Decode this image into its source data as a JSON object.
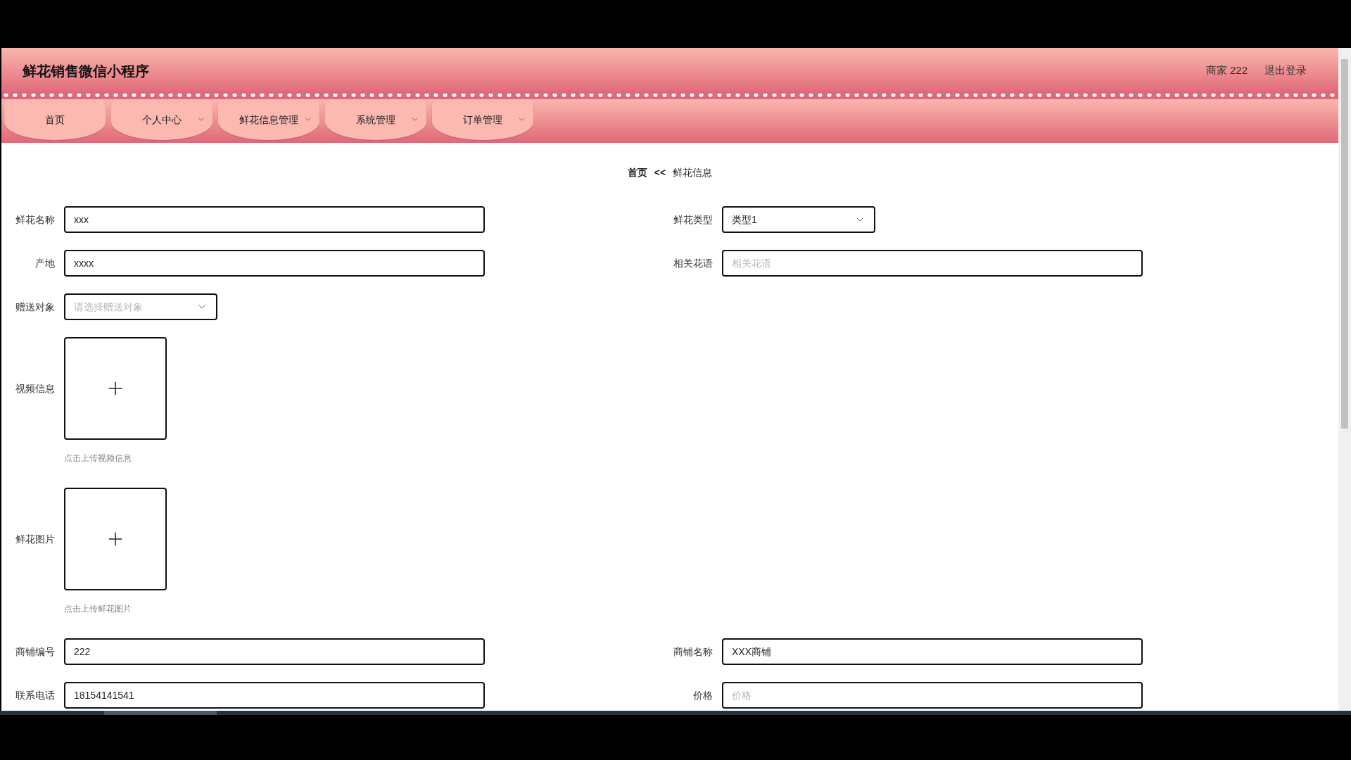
{
  "header": {
    "title": "鲜花销售微信小程序",
    "user": "商家 222",
    "logout": "退出登录"
  },
  "nav": [
    {
      "label": "首页",
      "dropdown": false
    },
    {
      "label": "个人中心",
      "dropdown": true
    },
    {
      "label": "鲜花信息管理",
      "dropdown": true
    },
    {
      "label": "系统管理",
      "dropdown": true
    },
    {
      "label": "订单管理",
      "dropdown": true
    }
  ],
  "breadcrumb": {
    "home": "首页",
    "separator": "<<",
    "current": "鲜花信息"
  },
  "form": {
    "rows": [
      [
        {
          "label": "鲜花名称",
          "kind": "text",
          "value": "xxx"
        },
        {
          "label": "鲜花类型",
          "kind": "select",
          "value": "类型1"
        }
      ],
      [
        {
          "label": "产地",
          "kind": "text",
          "value": "xxxx"
        },
        {
          "label": "相关花语",
          "kind": "text",
          "placeholder": "相关花语"
        }
      ],
      [
        {
          "label": "赠送对象",
          "kind": "select",
          "placeholder": "请选择赠送对象"
        }
      ],
      [
        {
          "label": "视频信息",
          "kind": "upload",
          "hint": "点击上传视频信息"
        }
      ],
      [
        {
          "label": "鲜花图片",
          "kind": "upload",
          "hint": "点击上传鲜花图片"
        }
      ],
      [
        {
          "label": "商铺编号",
          "kind": "text",
          "value": "222"
        },
        {
          "label": "商铺名称",
          "kind": "text",
          "value": "XXX商铺"
        }
      ],
      [
        {
          "label": "联系电话",
          "kind": "text",
          "value": "18154141541"
        },
        {
          "label": "价格",
          "kind": "text",
          "placeholder": "价格"
        }
      ]
    ]
  }
}
